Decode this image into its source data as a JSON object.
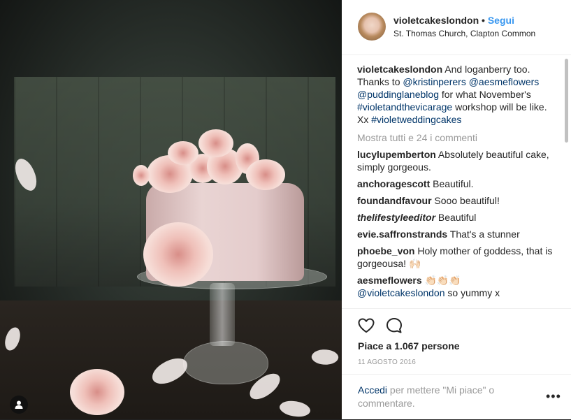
{
  "post": {
    "username": "violetcakeslondon",
    "separator": "•",
    "follow_label": "Segui",
    "location": "St. Thomas Church, Clapton Common"
  },
  "caption": {
    "username": "violetcakeslondon",
    "text_1": " And loganberry too. Thanks to ",
    "mention_1": "@kristinperers",
    "mention_2": "@aesmeflowers",
    "mention_3": "@puddinglaneblog",
    "text_2": " for what November's ",
    "hashtag_1": "#violetandthevicarage",
    "text_3": " workshop will be like. Xx ",
    "hashtag_2": "#violetweddingcakes"
  },
  "show_all_label": "Mostra tutti e 24 i commenti",
  "comments": [
    {
      "user": "lucylupemberton",
      "text": " Absolutely beautiful cake, simply gorgeous."
    },
    {
      "user": "anchoragescott",
      "text": " Beautiful."
    },
    {
      "user": "foundandfavour",
      "text": " Sooo beautiful!"
    },
    {
      "user": "thelifestyleeditor",
      "text": " Beautiful"
    },
    {
      "user": "evie.saffronstrands",
      "text": " That's a stunner"
    },
    {
      "user": "phoebe_von",
      "text": " Holy mother of goddess, that is gorgeousa! 🙌🏻"
    },
    {
      "user": "aesmeflowers",
      "text": " 👏🏻👏🏻👏🏻",
      "mention": "@violetcakeslondon",
      "text_after": " so yummy x"
    }
  ],
  "likes_label": "Piace a 1.067 persone",
  "date_label": "11 AGOSTO 2016",
  "footer": {
    "login_label": "Accedi",
    "text": " per mettere \"Mi piace\" o commentare.",
    "more_label": "•••"
  },
  "icons": {
    "like": "heart-icon",
    "comment": "comment-bubble-icon",
    "user_tag": "person-icon",
    "more": "more-options-icon"
  },
  "colors": {
    "link": "#003569",
    "follow": "#3897f0",
    "muted": "#999999",
    "text": "#262626"
  }
}
